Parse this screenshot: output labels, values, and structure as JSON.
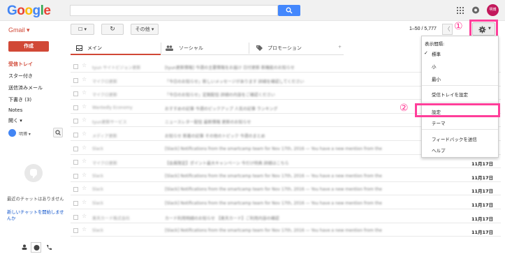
{
  "topbar": {
    "logo_letters": [
      {
        "ch": "G",
        "color": "#4285f4"
      },
      {
        "ch": "o",
        "color": "#ea4335"
      },
      {
        "ch": "o",
        "color": "#fbbc05"
      },
      {
        "ch": "g",
        "color": "#4285f4"
      },
      {
        "ch": "l",
        "color": "#34a853"
      },
      {
        "ch": "e",
        "color": "#ea4335"
      }
    ],
    "search_placeholder": "",
    "icons": [
      "search-icon",
      "apps-icon",
      "notifications-icon"
    ],
    "avatar_text": "明博"
  },
  "toolbar": {
    "app_label": "Gmail ▾",
    "select_label": "☐ ▾",
    "refresh_icon": "↻",
    "more_label": "その他 ▾",
    "pager_text": "1–50 / 5,777",
    "prev_label": "〈"
  },
  "annotations": {
    "step1": "①",
    "step2": "②",
    "highlight_color": "#ff3e9a"
  },
  "sidebar": {
    "compose_label": "作成",
    "items": [
      {
        "label": "受信トレイ",
        "active": true
      },
      {
        "label": "スター付き",
        "active": false
      },
      {
        "label": "送信済みメール",
        "active": false
      },
      {
        "label": "下書き (3)",
        "active": false
      },
      {
        "label": "Notes",
        "active": false
      },
      {
        "label": "開く ▾",
        "active": false
      }
    ],
    "chat_user": "明博 ▾",
    "no_chat_text": "最近のチャットはありません",
    "new_chat_link": "新しいチャットを開始しませんか"
  },
  "tabs": [
    {
      "label": "メイン",
      "icon": "inbox-icon"
    },
    {
      "label": "ソーシャル",
      "icon": "people-icon"
    },
    {
      "label": "プロモーション",
      "icon": "tag-icon"
    }
  ],
  "mails": [
    {
      "sender": "tyun サイトビジョン更新",
      "subject": "[tyun更新情報] 今週の主要情報をお届け 日付更新 新機能のお知らせ",
      "date": ""
    },
    {
      "sender": "マイクロ更新",
      "subject": "「今日のお知らせ」新しいメッセージがあります 詳細を確認してください",
      "date": ""
    },
    {
      "sender": "マイクロ更新",
      "subject": "「今日のお知らせ」定期配信 詳細の内容をご確認ください",
      "date": ""
    },
    {
      "sender": "Wantedly Economy",
      "subject": "おすすめの記事 今週のピックアップ 人気の記事 ランキング",
      "date": ""
    },
    {
      "sender": "tyun更新サービス",
      "subject": "ニュースレター配信 最新情報 更新のお知らせ",
      "date": ""
    },
    {
      "sender": "メディア更新",
      "subject": "お知らせ 新着の記事 その他のトピック 今週のまとめ",
      "date": ""
    },
    {
      "sender": "Slack",
      "subject": "[Slack] Notifications from the smartcamp team for Nov 17th, 2016 — You have a new mention from the",
      "date": ""
    },
    {
      "sender": "マイクロ更新",
      "subject": "【会員限定】ポイント最大キャンペーン 今だけ特典 詳細はこちら",
      "date": "11月17日"
    },
    {
      "sender": "Slack",
      "subject": "[Slack] Notifications from the smartcamp team for Nov 17th, 2016 — You have a new mention from the",
      "date": "11月17日"
    },
    {
      "sender": "Slack",
      "subject": "[Slack] Notifications from the smartcamp team for Nov 17th, 2016 — You have a new mention from the",
      "date": "11月17日"
    },
    {
      "sender": "Slack",
      "subject": "[Slack] Notifications from the smartcamp team for Nov 17th, 2016 — You have a new mention from the",
      "date": "11月17日"
    },
    {
      "sender": "楽天カード株式会社",
      "subject": "カード利用明細のお知らせ 【楽天カード】ご利用内容の確認",
      "date": "11月17日"
    },
    {
      "sender": "Slack",
      "subject": "[Slack] Notifications from the smartcamp team for Nov 17th, 2016 — You have a new mention from the",
      "date": "11月17日"
    }
  ],
  "settings_menu": {
    "density_header": "表示間隔:",
    "density_options": [
      {
        "label": "標準",
        "checked": true
      },
      {
        "label": "小",
        "checked": false
      },
      {
        "label": "最小",
        "checked": false
      }
    ],
    "inbox_settings": "受信トレイを設定",
    "settings": "設定",
    "themes": "テーマ",
    "feedback": "フィードバックを送信",
    "help": "ヘルプ"
  },
  "footer_icons": [
    "person-icon",
    "hangouts-icon",
    "phone-icon"
  ]
}
